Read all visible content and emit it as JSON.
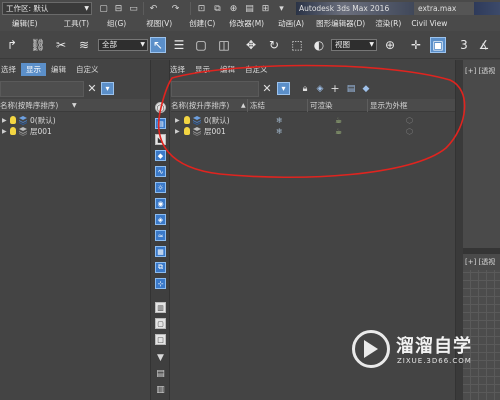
{
  "app": {
    "workspace_label": "工作区: 默认",
    "title": "Autodesk 3ds Max 2016",
    "file": "extra.max"
  },
  "menu": [
    "编辑(E)",
    "工具(T)",
    "组(G)",
    "视图(V)",
    "创建(C)",
    "修改器(M)",
    "动画(A)",
    "图形编辑器(D)",
    "渲染(R)",
    "Civil View"
  ],
  "toolbar": {
    "selection_filter": "全部",
    "reference_coord": "视图"
  },
  "explorer_left": {
    "tabs": [
      "选择",
      "显示",
      "编辑",
      "自定义"
    ],
    "active_tab": "显示",
    "column_name": "名称(按降序排序)",
    "rows": [
      {
        "label": "0(默认)"
      },
      {
        "label": "层001"
      }
    ]
  },
  "explorer_right": {
    "tabs": [
      "选择",
      "显示",
      "编辑",
      "自定义"
    ],
    "columns": {
      "name": "名称(按升序排序)",
      "freeze": "冻结",
      "renderable": "可渲染",
      "box": "显示为外框"
    },
    "rows": [
      {
        "label": "0(默认)"
      },
      {
        "label": "层001"
      }
    ]
  },
  "viewport": {
    "label_top": "[+] [透视",
    "label_bottom": "[+] [透视"
  },
  "watermark": {
    "title": "溜溜自学",
    "url": "ZIXUE.3D66.COM"
  },
  "colors": {
    "accent": "#5b8fc9",
    "annotation": "#e0241f"
  }
}
